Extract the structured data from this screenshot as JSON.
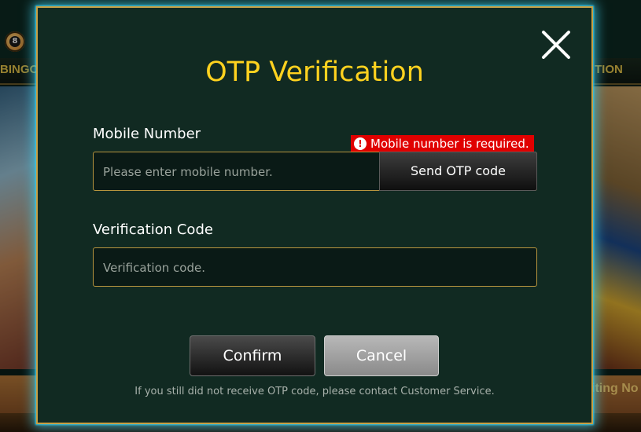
{
  "background": {
    "nav_left": "BINGO",
    "nav_right": "TION",
    "logo_badge": "8",
    "strip_text": "iting No"
  },
  "modal": {
    "title": "OTP Verification",
    "close_icon": "close-icon",
    "mobile": {
      "label": "Mobile Number",
      "placeholder": "Please enter mobile number.",
      "value": "",
      "error": "Mobile number is required.",
      "error_icon": "alert-icon",
      "send_button": "Send OTP code"
    },
    "verification": {
      "label": "Verification Code",
      "placeholder": "Verification code.",
      "value": ""
    },
    "confirm_label": "Confirm",
    "cancel_label": "Cancel",
    "footnote": "If you still did not receive OTP code, please contact Customer Service."
  },
  "colors": {
    "title": "#ffd21f",
    "border": "#c7a045",
    "glow": "#2ec7e8",
    "error": "#e00000"
  }
}
